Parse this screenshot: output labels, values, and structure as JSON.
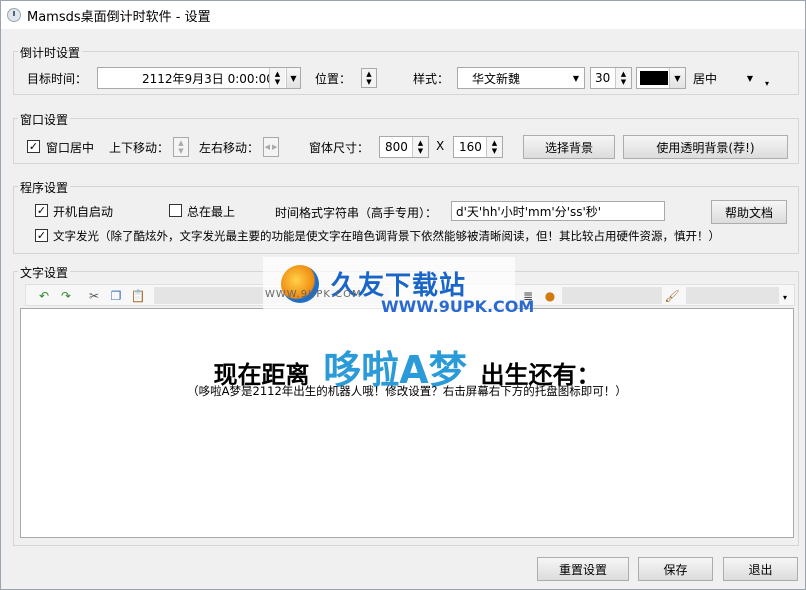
{
  "window": {
    "title": "Mamsds桌面倒计时软件 - 设置"
  },
  "countdown_group": {
    "label": "倒计时设置",
    "target_label": "目标时间：",
    "target_value": "2112年9月3日 0:00:00",
    "position_label": "位置：",
    "style_label": "样式：",
    "font_value": "华文新魏",
    "size_value": "30",
    "color": "#000000",
    "align_value": "居中"
  },
  "window_group": {
    "label": "窗口设置",
    "center_label": "窗口居中",
    "center_checked": "✓",
    "updown_label": "上下移动：",
    "leftright_label": "左右移动：",
    "size_label": "窗体尺寸：",
    "width_value": "800",
    "x_sep": "X",
    "height_value": "160",
    "choose_bg": "选择背景",
    "transparent_bg": "使用透明背景(荐!)"
  },
  "program_group": {
    "label": "程序设置",
    "autostart_label": "开机自启动",
    "autostart_checked": "✓",
    "ontop_label": "总在最上",
    "format_label": "时间格式字符串（高手专用）：",
    "format_value": "d'天'hh'小时'mm'分'ss'秒'",
    "help_button": "帮助文档",
    "glow_label": "文字发光（除了酷炫外，文字发光最主要的功能是使文字在暗色调背景下依然能够被清晰阅读，但！其比较占用硬件资源，慎开！）",
    "glow_checked": "✓"
  },
  "text_group": {
    "label": "文字设置",
    "line1_prefix": "现在距离",
    "line1_name": "哆啦A梦",
    "line1_suffix": "出生还有：",
    "line2": "（哆啦A梦是2112年出生的机器人哦！修改设置？右击屏幕右下方的托盘图标即可！）"
  },
  "watermark": {
    "brand": "久友下载站",
    "url": "WWW.9UPK.COM"
  },
  "footer": {
    "reset": "重置设置",
    "save": "保存",
    "exit": "退出"
  },
  "icons": [
    "app-clock-icon",
    "dropdown-arrow-icon",
    "spin-updown-icon",
    "undo-icon",
    "redo-icon",
    "cut-icon",
    "copy-icon",
    "paste-icon",
    "align-justify-icon",
    "color-palette-icon",
    "brush-icon"
  ]
}
